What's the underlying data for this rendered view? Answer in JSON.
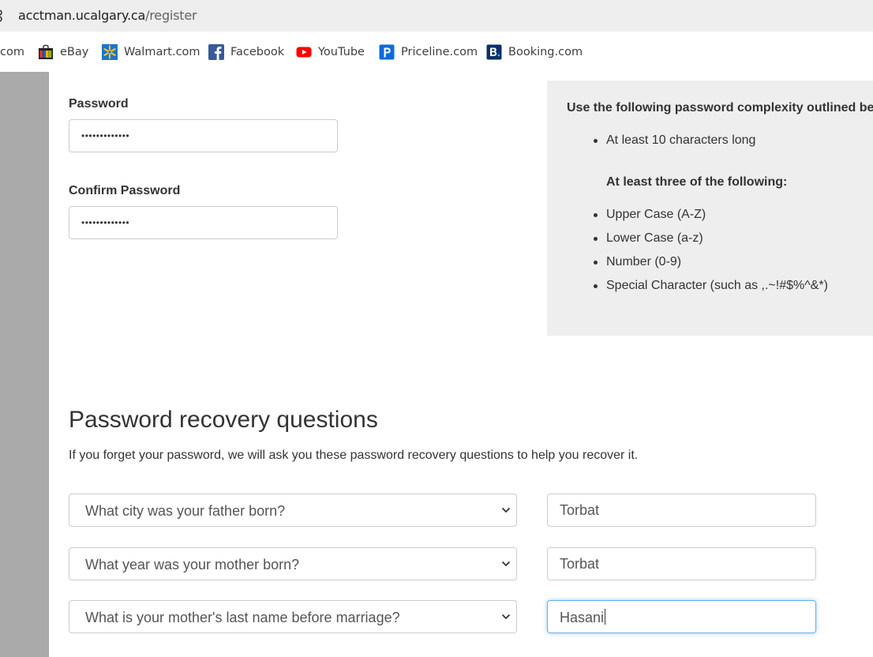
{
  "browser": {
    "url_host": "acctman.ucalgary.ca",
    "url_path": "/register",
    "bookmarks": [
      {
        "label": "com",
        "icon": "partial-bookmark-icon"
      },
      {
        "label": "eBay",
        "icon": "ebay-icon"
      },
      {
        "label": "Walmart.com",
        "icon": "walmart-icon"
      },
      {
        "label": "Facebook",
        "icon": "facebook-icon"
      },
      {
        "label": "YouTube",
        "icon": "youtube-icon"
      },
      {
        "label": "Priceline.com",
        "icon": "priceline-icon"
      },
      {
        "label": "Booking.com",
        "icon": "booking-icon"
      }
    ]
  },
  "password": {
    "label": "Password",
    "value_masked": "•••••••••••••",
    "confirm_label": "Confirm Password",
    "confirm_value_masked": "•••••••••••••"
  },
  "complexity": {
    "title": "Use the following password complexity outlined below",
    "first_item": "At least 10 characters long",
    "subheading": "At least three of the following:",
    "items": [
      "Upper Case (A-Z)",
      "Lower Case (a-z)",
      "Number (0-9)",
      "Special Character (such as ,.~!#$%^&*)"
    ]
  },
  "recovery": {
    "heading": "Password recovery questions",
    "description": "If you forget your password, we will ask you these password recovery questions to help you recover it.",
    "questions": [
      {
        "question": "What city was your father born?",
        "answer": "Torbat"
      },
      {
        "question": "What year was your mother born?",
        "answer": "Torbat"
      },
      {
        "question": "What is your mother's last name before marriage?",
        "answer": "Hasani"
      }
    ]
  },
  "colors": {
    "info_panel_bg": "#eeeeee",
    "left_bar": "#aaaaaa",
    "focus_border": "#66afe9"
  }
}
